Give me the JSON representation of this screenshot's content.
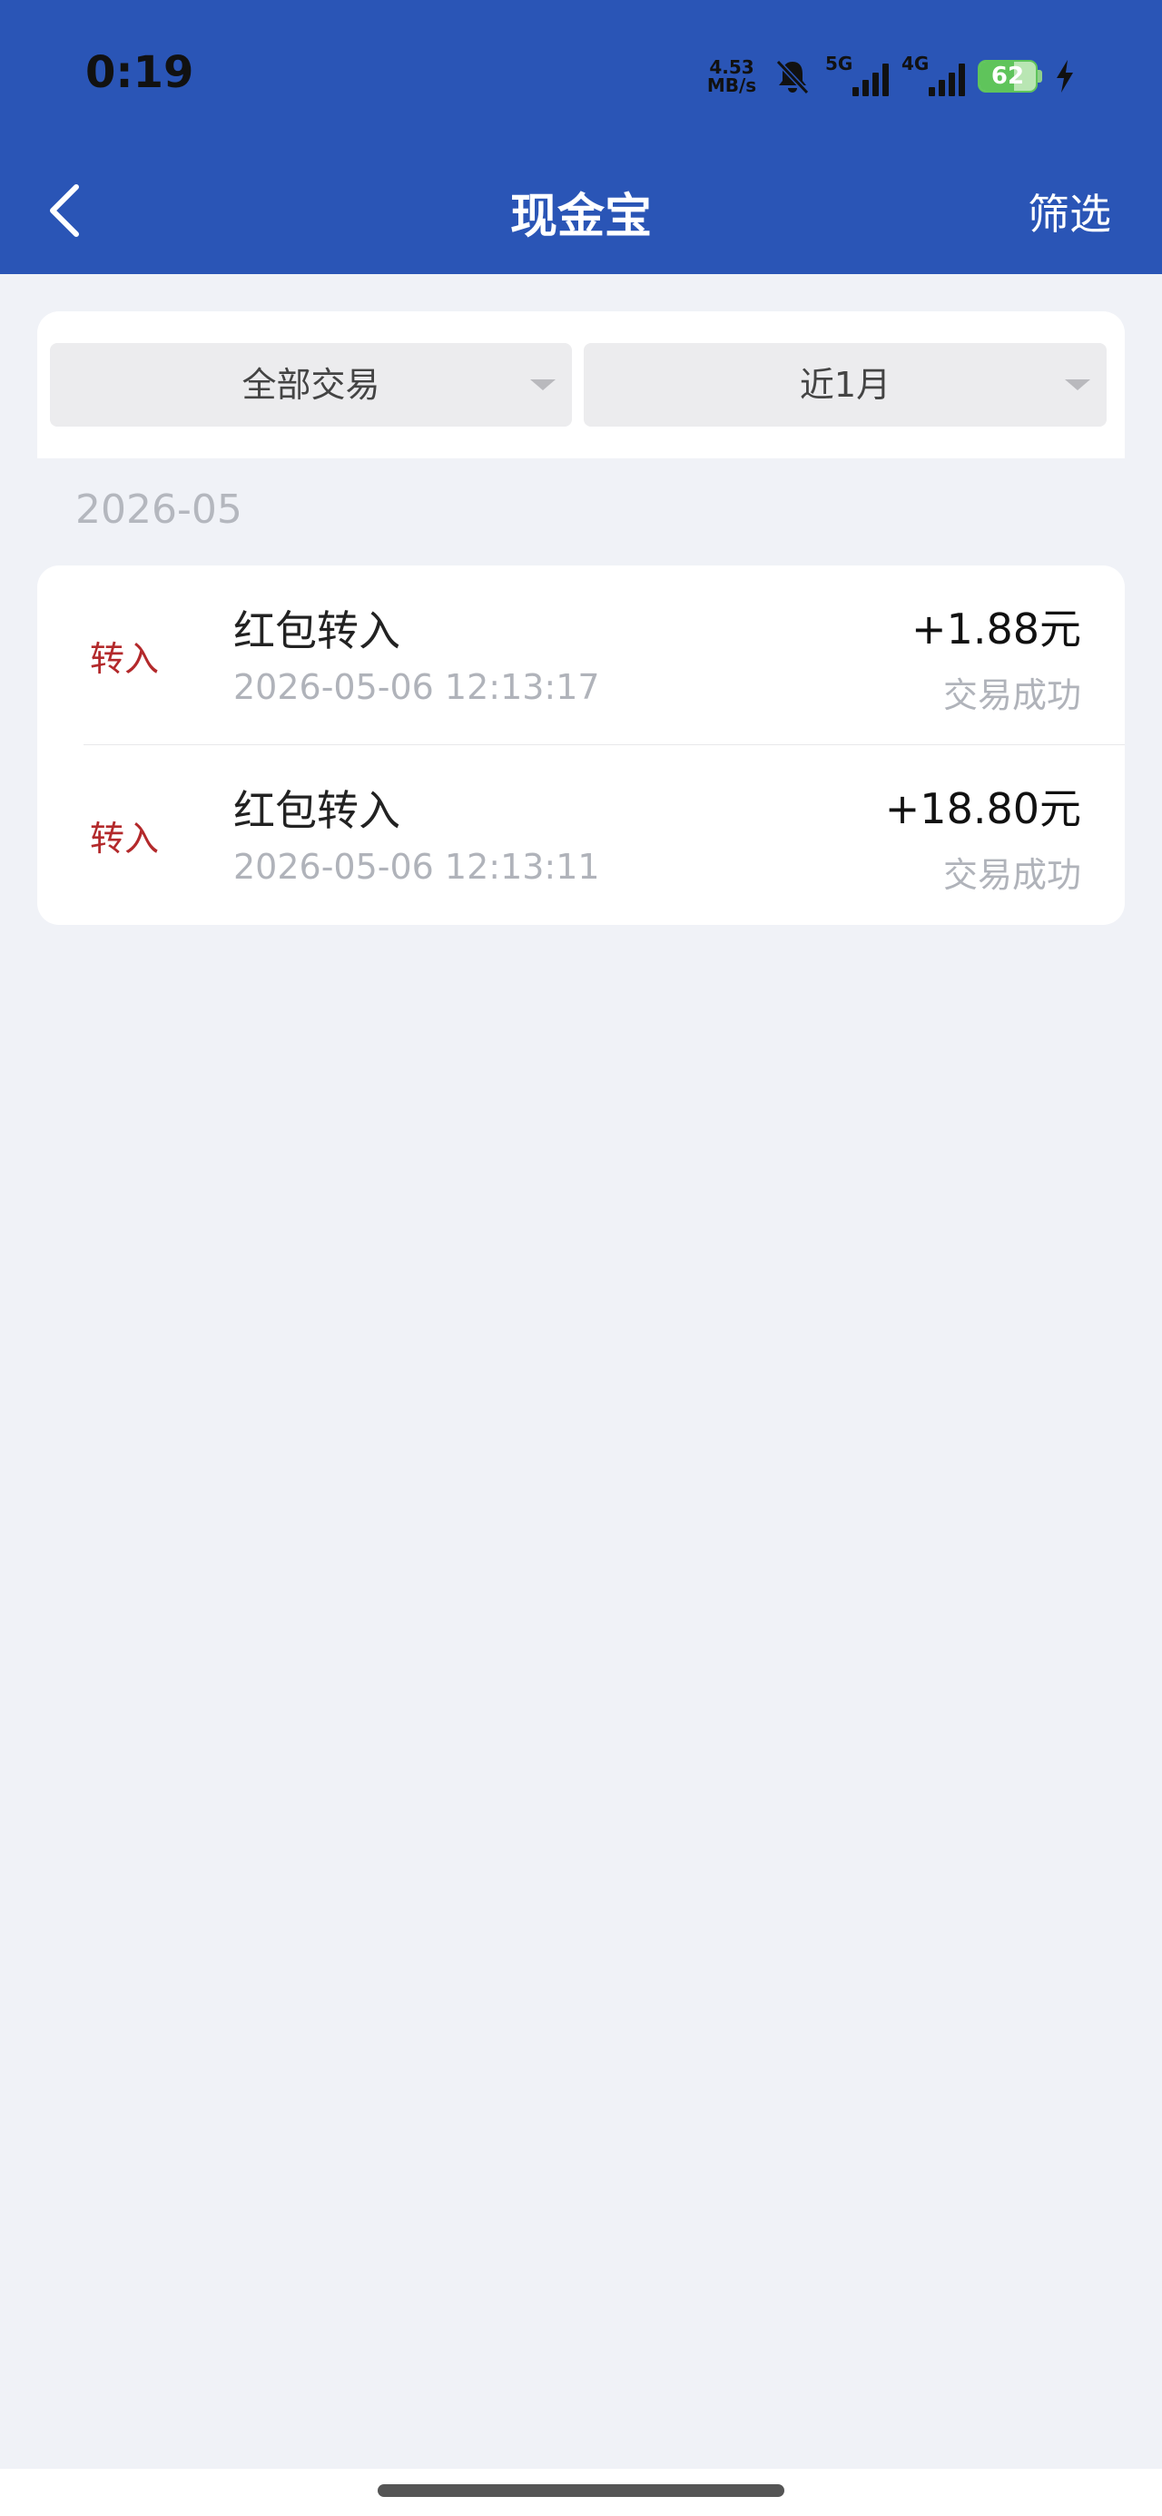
{
  "status_bar": {
    "time": "0:19",
    "speed_value": "4.53",
    "speed_unit": "MB/s",
    "signal1_label": "5G",
    "signal2_label": "4G",
    "battery_level": "62",
    "battery_fraction": 0.62,
    "icons": [
      "bell-off-icon",
      "signal-icon",
      "battery-icon",
      "charging-icon"
    ]
  },
  "nav": {
    "title": "现金宝",
    "filter_label": "筛选",
    "back_icon": "chevron-left-icon"
  },
  "filters": {
    "type_selected": "全部交易",
    "period_selected": "近1月"
  },
  "month_header": "2026-05",
  "transactions": [
    {
      "type": "转入",
      "title": "红包转入",
      "datetime": "2026-05-06 12:13:17",
      "amount": "+1.88元",
      "status": "交易成功"
    },
    {
      "type": "转入",
      "title": "红包转入",
      "datetime": "2026-05-06 12:13:11",
      "amount": "+18.80元",
      "status": "交易成功"
    }
  ],
  "colors": {
    "header_bg": "#2a55b6",
    "page_bg": "#f0f2f7",
    "type_red": "#b3292b",
    "muted_text": "#b0b3ba",
    "battery_green": "#5fc45b"
  }
}
